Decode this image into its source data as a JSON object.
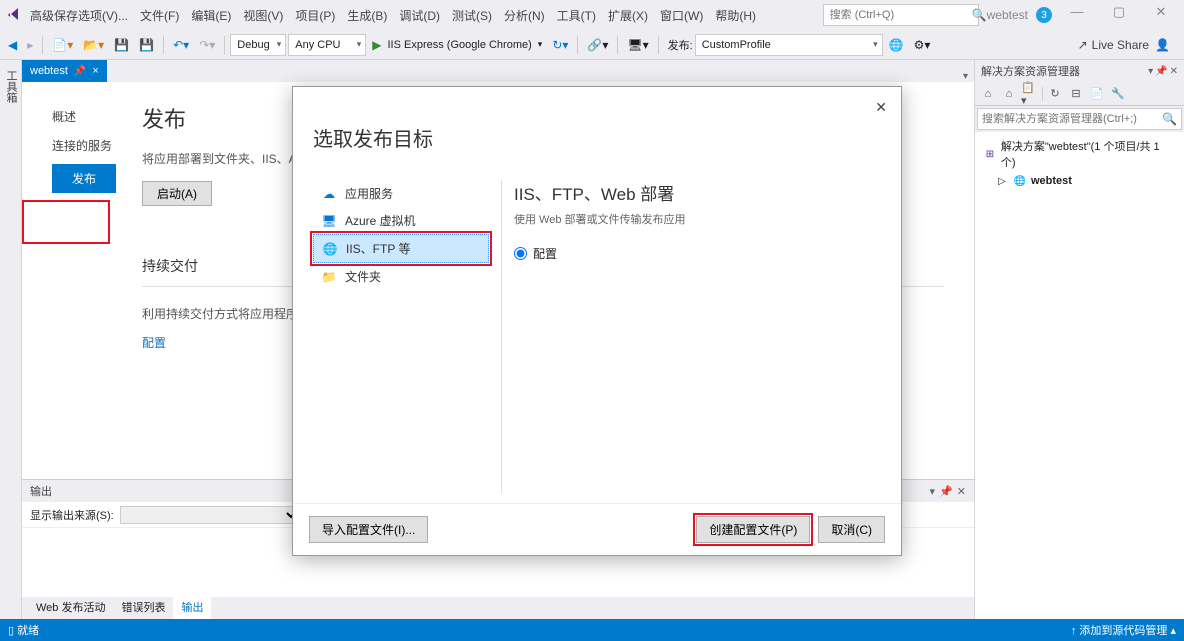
{
  "titleBar": {
    "appTitle": "高级保存选项(V)...",
    "menus": [
      "文件(F)",
      "编辑(E)",
      "视图(V)",
      "项目(P)",
      "生成(B)",
      "调试(D)",
      "测试(S)",
      "分析(N)",
      "工具(T)",
      "扩展(X)",
      "窗口(W)",
      "帮助(H)"
    ],
    "searchPlaceholder": "搜索 (Ctrl+Q)",
    "projectName": "webtest",
    "badge": "3",
    "liveShare": "Live Share"
  },
  "toolbar": {
    "config": "Debug",
    "platform": "Any CPU",
    "runTarget": "IIS Express (Google Chrome)",
    "publishLabel": "发布:",
    "publishProfile": "CustomProfile"
  },
  "docTab": {
    "name": "webtest",
    "close": "×"
  },
  "publishPage": {
    "nav": {
      "overview": "概述",
      "connected": "连接的服务",
      "publish": "发布"
    },
    "title": "发布",
    "desc": "将应用部署到文件夹、IIS、Azure 或其",
    "launchBtn": "启动(A)",
    "cdTitle": "持续交付",
    "cdDesc": "利用持续交付方式将应用程序自动发布",
    "configLink": "配置"
  },
  "dialog": {
    "title": "选取发布目标",
    "nav": [
      {
        "icon": "app",
        "label": "应用服务"
      },
      {
        "icon": "vm",
        "label": "Azure 虚拟机"
      },
      {
        "icon": "iis",
        "label": "IIS、FTP 等"
      },
      {
        "icon": "folder",
        "label": "文件夹"
      }
    ],
    "mainTitle": "IIS、FTP、Web 部署",
    "mainSub": "使用 Web 部署或文件传输发布应用",
    "radioConfig": "配置",
    "importBtn": "导入配置文件(I)...",
    "createBtn": "创建配置文件(P)",
    "cancelBtn": "取消(C)"
  },
  "output": {
    "header": "输出",
    "sourceLabel": "显示输出来源(S):",
    "tabs": [
      "Web 发布活动",
      "错误列表",
      "输出"
    ]
  },
  "solutionExplorer": {
    "header": "解决方案资源管理器",
    "searchPlaceholder": "搜索解决方案资源管理器(Ctrl+;)",
    "solutionLabel": "解决方案\"webtest\"(1 个项目/共 1 个)",
    "projectLabel": "webtest"
  },
  "statusBar": {
    "ready": "就绪",
    "sourceControl": "添加到源代码管理"
  },
  "leftStrip": {
    "toolbox": "工具箱"
  }
}
